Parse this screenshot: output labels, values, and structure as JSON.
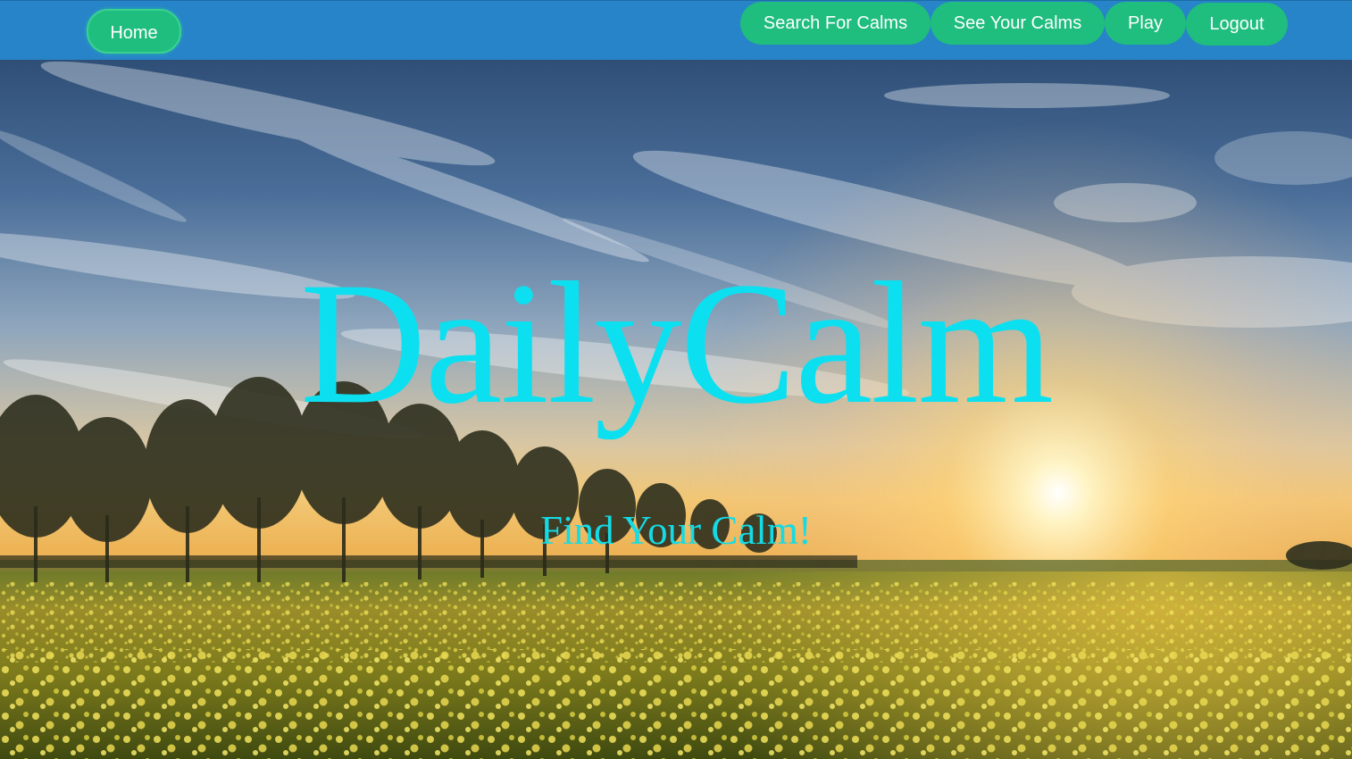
{
  "nav": {
    "home_label": "Home",
    "search_label": "Search For Calms",
    "see_label": "See Your Calms",
    "play_label": "Play",
    "logout_label": "Logout"
  },
  "hero": {
    "title": "DailyCalm",
    "subtitle": "Find Your Calm!",
    "background": "sunset-meadow-image"
  },
  "colors": {
    "navbar": "#2784c8",
    "button": "#1fbd7e",
    "title": "#0ce0f0"
  }
}
